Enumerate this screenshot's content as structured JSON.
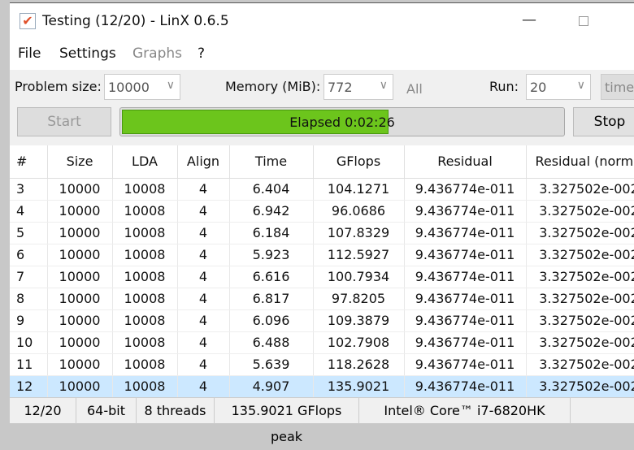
{
  "window": {
    "title": "Testing (12/20) - LinX 0.6.5",
    "icon": "checkmark-icon"
  },
  "menu": [
    "File",
    "Settings",
    "Graphs",
    "?"
  ],
  "controls": {
    "problem_size_label": "Problem size:",
    "problem_size": "10000",
    "memory_label": "Memory (MiB):",
    "memory": "772",
    "all_label": "All",
    "run_label": "Run:",
    "run": "20",
    "times_label": "times"
  },
  "buttons": {
    "start": "Start",
    "stop": "Stop"
  },
  "progress": {
    "text": "Elapsed 0:02:26",
    "fraction": 0.6,
    "color": "#6cc51c"
  },
  "table": {
    "columns": [
      "#",
      "Size",
      "LDA",
      "Align",
      "Time",
      "GFlops",
      "Residual",
      "Residual (norm.)"
    ],
    "rows": [
      [
        "3",
        "10000",
        "10008",
        "4",
        "6.404",
        "104.1271",
        "9.436774e-011",
        "3.327502e-002"
      ],
      [
        "4",
        "10000",
        "10008",
        "4",
        "6.942",
        "96.0686",
        "9.436774e-011",
        "3.327502e-002"
      ],
      [
        "5",
        "10000",
        "10008",
        "4",
        "6.184",
        "107.8329",
        "9.436774e-011",
        "3.327502e-002"
      ],
      [
        "6",
        "10000",
        "10008",
        "4",
        "5.923",
        "112.5927",
        "9.436774e-011",
        "3.327502e-002"
      ],
      [
        "7",
        "10000",
        "10008",
        "4",
        "6.616",
        "100.7934",
        "9.436774e-011",
        "3.327502e-002"
      ],
      [
        "8",
        "10000",
        "10008",
        "4",
        "6.817",
        "97.8205",
        "9.436774e-011",
        "3.327502e-002"
      ],
      [
        "9",
        "10000",
        "10008",
        "4",
        "6.096",
        "109.3879",
        "9.436774e-011",
        "3.327502e-002"
      ],
      [
        "10",
        "10000",
        "10008",
        "4",
        "6.488",
        "102.7908",
        "9.436774e-011",
        "3.327502e-002"
      ],
      [
        "11",
        "10000",
        "10008",
        "4",
        "5.639",
        "118.2628",
        "9.436774e-011",
        "3.327502e-002"
      ],
      [
        "12",
        "10000",
        "10008",
        "4",
        "4.907",
        "135.9021",
        "9.436774e-011",
        "3.327502e-002"
      ]
    ],
    "selected_row": 9
  },
  "status": [
    "12/20",
    "64-bit",
    "8 threads",
    "135.9021 GFlops peak",
    "Intel® Core™ i7-6820HK"
  ]
}
